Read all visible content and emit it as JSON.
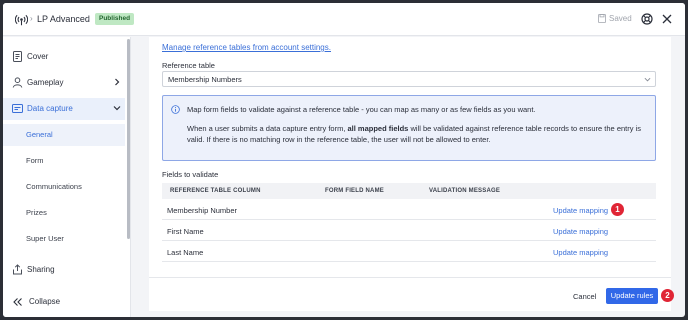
{
  "header": {
    "title": "LP Advanced",
    "badge": "Published",
    "saved_label": "Saved"
  },
  "sidebar": {
    "items": [
      {
        "label": "Cover",
        "icon": "document-icon"
      },
      {
        "label": "Gameplay",
        "icon": "person-icon"
      },
      {
        "label": "Data capture",
        "icon": "data-capture-icon"
      }
    ],
    "sub_items": [
      {
        "label": "General"
      },
      {
        "label": "Form"
      },
      {
        "label": "Communications"
      },
      {
        "label": "Prizes"
      },
      {
        "label": "Super User"
      }
    ],
    "sharing_label": "Sharing",
    "collapse_label": "Collapse"
  },
  "main": {
    "manage_link": "Manage reference tables from account settings.",
    "reference_label": "Reference table",
    "reference_value": "Membership Numbers",
    "info": {
      "line1": "Map form fields to validate against a reference table - you can map as many or as few fields as you want.",
      "line2_before": "When a user submits a data capture entry form, ",
      "line2_bold": "all mapped fields",
      "line2_after": " will be validated against reference table records to ensure the entry is valid. If there is no matching row in the reference table, the user will not be allowed to enter."
    },
    "fields_label": "Fields to validate",
    "columns": [
      "REFERENCE TABLE COLUMN",
      "FORM FIELD NAME",
      "VALIDATION MESSAGE"
    ],
    "rows": [
      {
        "name": "Membership Number",
        "action": "Update mapping"
      },
      {
        "name": "First Name",
        "action": "Update mapping"
      },
      {
        "name": "Last Name",
        "action": "Update mapping"
      }
    ],
    "markers": [
      "1",
      "2"
    ],
    "cancel_label": "Cancel",
    "primary_label": "Update rules"
  },
  "colors": {
    "accent": "#3168e8",
    "link": "#3a6fd8",
    "badge_bg": "#bfe8c3",
    "marker": "#e02535"
  }
}
